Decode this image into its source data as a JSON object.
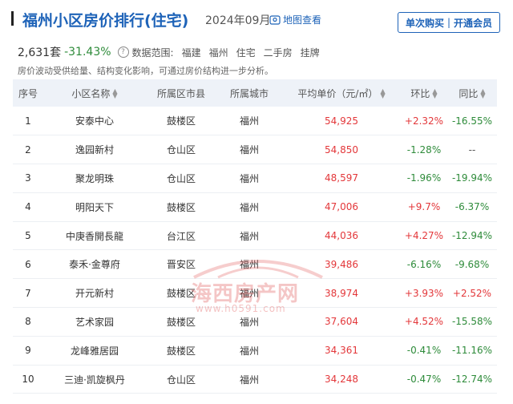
{
  "header": {
    "title": "福州小区房价排行(住宅)",
    "period": "2024年09月",
    "map_link": "地图查看",
    "buy_label": "单次购买",
    "sep": "|",
    "member_label": "开通会员"
  },
  "stats": {
    "count": "2,631套",
    "change": "-31.43%",
    "info_glyph": "?",
    "range_label": "数据范围:",
    "tags": [
      "福建",
      "福州",
      "住宅",
      "二手房",
      "挂牌"
    ]
  },
  "note": "房价波动受供给量、结构变化影响，可通过房价结构进一步分析。",
  "table": {
    "headers": [
      "序号",
      "小区名称",
      "所属区市县",
      "所属城市",
      "平均单价（元/㎡）",
      "环比",
      "同比"
    ],
    "rows": [
      {
        "no": "1",
        "name": "安泰中心",
        "district": "鼓楼区",
        "city": "福州",
        "price": "54,925",
        "mom": "+2.32%",
        "mom_dir": "up",
        "yoy": "-16.55%",
        "yoy_dir": "down"
      },
      {
        "no": "2",
        "name": "逸园新村",
        "district": "仓山区",
        "city": "福州",
        "price": "54,850",
        "mom": "-1.28%",
        "mom_dir": "down",
        "yoy": "--",
        "yoy_dir": "flat"
      },
      {
        "no": "3",
        "name": "聚龙明珠",
        "district": "仓山区",
        "city": "福州",
        "price": "48,597",
        "mom": "-1.96%",
        "mom_dir": "down",
        "yoy": "-19.94%",
        "yoy_dir": "down"
      },
      {
        "no": "4",
        "name": "明阳天下",
        "district": "鼓楼区",
        "city": "福州",
        "price": "47,006",
        "mom": "+9.7%",
        "mom_dir": "up",
        "yoy": "-6.37%",
        "yoy_dir": "down"
      },
      {
        "no": "5",
        "name": "中庚香開長龍",
        "district": "台江区",
        "city": "福州",
        "price": "44,036",
        "mom": "+4.27%",
        "mom_dir": "up",
        "yoy": "-12.94%",
        "yoy_dir": "down"
      },
      {
        "no": "6",
        "name": "泰禾·金尊府",
        "district": "晋安区",
        "city": "福州",
        "price": "39,486",
        "mom": "-6.16%",
        "mom_dir": "down",
        "yoy": "-9.68%",
        "yoy_dir": "down"
      },
      {
        "no": "7",
        "name": "开元新村",
        "district": "鼓楼区",
        "city": "福州",
        "price": "38,974",
        "mom": "+3.93%",
        "mom_dir": "up",
        "yoy": "+2.52%",
        "yoy_dir": "up"
      },
      {
        "no": "8",
        "name": "艺术家园",
        "district": "鼓楼区",
        "city": "福州",
        "price": "37,604",
        "mom": "+4.52%",
        "mom_dir": "up",
        "yoy": "-15.58%",
        "yoy_dir": "down"
      },
      {
        "no": "9",
        "name": "龙峰雅居园",
        "district": "鼓楼区",
        "city": "福州",
        "price": "34,361",
        "mom": "-0.41%",
        "mom_dir": "down",
        "yoy": "-11.16%",
        "yoy_dir": "down"
      },
      {
        "no": "10",
        "name": "三迪·凯旋枫丹",
        "district": "仓山区",
        "city": "福州",
        "price": "34,248",
        "mom": "-0.47%",
        "mom_dir": "down",
        "yoy": "-12.74%",
        "yoy_dir": "down"
      }
    ]
  },
  "watermark": {
    "text": "海西房产网",
    "url": "www.h0591.com"
  },
  "colors": {
    "accent": "#1e63b8",
    "up": "#e3373a",
    "down": "#2e8b3a",
    "header_bg": "#eef2f8"
  },
  "icons": {
    "map": "map-pin-icon",
    "sort": "sort-arrows-icon",
    "info": "question-circle-icon"
  }
}
